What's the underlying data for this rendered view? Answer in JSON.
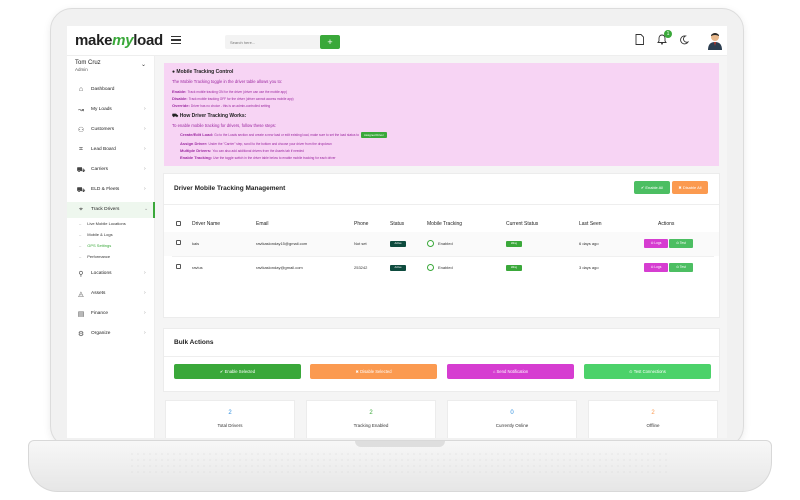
{
  "colors": {
    "brand_green": "#3aa83a",
    "info_bg": "#f7d4f4",
    "info_text": "#9b27a0",
    "orange": "#fb9a50",
    "magenta": "#d63dd1",
    "dark_green": "#0e4b3e",
    "blue": "#2f8fdf"
  },
  "topbar": {
    "logo_make": "make",
    "logo_my": "my",
    "logo_load": "load",
    "search_placeholder": "Search here...",
    "add_label": "+",
    "notification_count": "1",
    "icons": [
      "menu-icon",
      "document-icon",
      "bell-icon",
      "moon-icon",
      "avatar"
    ]
  },
  "sidebar": {
    "user_name": "Tom Cruz",
    "user_role": "Admin",
    "user_chevron": "⌄",
    "items": [
      {
        "label": "Dashboard",
        "icon": "⌂",
        "chev": ""
      },
      {
        "label": "My Loads",
        "icon": "↝",
        "chev": "›"
      },
      {
        "label": "Customers",
        "icon": "⚇",
        "chev": "›"
      },
      {
        "label": "Lead Board",
        "icon": "⌗",
        "chev": "›"
      },
      {
        "label": "Carriers",
        "icon": "⛟",
        "chev": "›"
      },
      {
        "label": "ELD & Fleets",
        "icon": "⛟",
        "chev": "›"
      },
      {
        "label": "Track Drivers",
        "icon": "⌖",
        "chev": "⌄"
      },
      {
        "label": "Locations",
        "icon": "⚲",
        "chev": "›"
      },
      {
        "label": "Assets",
        "icon": "◬",
        "chev": "›"
      },
      {
        "label": "Finance",
        "icon": "▤",
        "chev": "›"
      },
      {
        "label": "Organize",
        "icon": "⚙",
        "chev": "›"
      }
    ],
    "sub_items": [
      {
        "label": "Live Mobile Locations"
      },
      {
        "label": "Mobile & Logs"
      },
      {
        "label": "GPS Settings"
      },
      {
        "label": "Performance"
      }
    ]
  },
  "info": {
    "title": "Mobile Tracking Control",
    "subtitle": "The Mobile Tracking toggle in the driver table allows you to:",
    "lines": [
      {
        "bold": "Enable:",
        "rest": "Track mobile tracking ON for the driver (driver can use the mobile app)"
      },
      {
        "bold": "Disable:",
        "rest": "Track mobile tracking OFF for the driver (driver cannot access mobile app)"
      },
      {
        "bold": "Override:",
        "rest": "Driver has no choice - this is an admin-controlled setting"
      }
    ],
    "how_title": "How Driver Tracking Works:",
    "how_subtitle": "To enable mobile tracking for drivers, follow these steps:",
    "steps": [
      {
        "bold": "Create/Edit Load:",
        "rest": "Go to the Loads section and create a new load or edit existing load, make sure to set the load status to",
        "badge": "Assigned Driver"
      },
      {
        "bold": "Assign Driver:",
        "rest": "Under the \"Carrier\" step, scroll to the bottom and choose your driver from the dropdown"
      },
      {
        "bold": "Multiple Drivers:",
        "rest": "You can also add additional drivers from the Assets tab if needed"
      },
      {
        "bold": "Enable Tracking:",
        "rest": "Use the toggle switch in the driver table below to enable mobile tracking for each driver"
      }
    ]
  },
  "drivers_card": {
    "title": "Driver Mobile Tracking Management",
    "enable_all": "✔ Enable All",
    "disable_all": "✖ Disable All",
    "columns": [
      "Driver Name",
      "Email",
      "Phone",
      "Status",
      "Mobile Tracking",
      "Current Status",
      "Last Seen",
      "Actions"
    ],
    "rows": [
      {
        "name": "kais",
        "email": "ravikaslonday15@gmail.com",
        "phone": "Not set",
        "status": "Active",
        "tracking": "Enabled",
        "current": "Idling",
        "last_seen": "6 days ago",
        "logs": "⊙ Logs",
        "test": "⊙ Test"
      },
      {
        "name": "ravius",
        "email": "ravikaslonday@gmail.com",
        "phone": "253242",
        "status": "Active",
        "tracking": "Enabled",
        "current": "Idling",
        "last_seen": "3 days ago",
        "logs": "⊙ Logs",
        "test": "⊙ Test"
      }
    ]
  },
  "bulk": {
    "title": "Bulk Actions",
    "enable_selected": "✔ Enable Selected",
    "disable_selected": "✖ Disable Selected",
    "send_notification": "⌂ Send Notification",
    "test_connections": "⊙ Test Connections"
  },
  "stats": [
    {
      "value": "2",
      "label": "Total Drivers",
      "color": "#2f8fdf"
    },
    {
      "value": "2",
      "label": "Tracking Enabled",
      "color": "#3aa83a"
    },
    {
      "value": "0",
      "label": "Currently Online",
      "color": "#2f8fdf"
    },
    {
      "value": "2",
      "label": "Offline",
      "color": "#fb9a50"
    }
  ]
}
